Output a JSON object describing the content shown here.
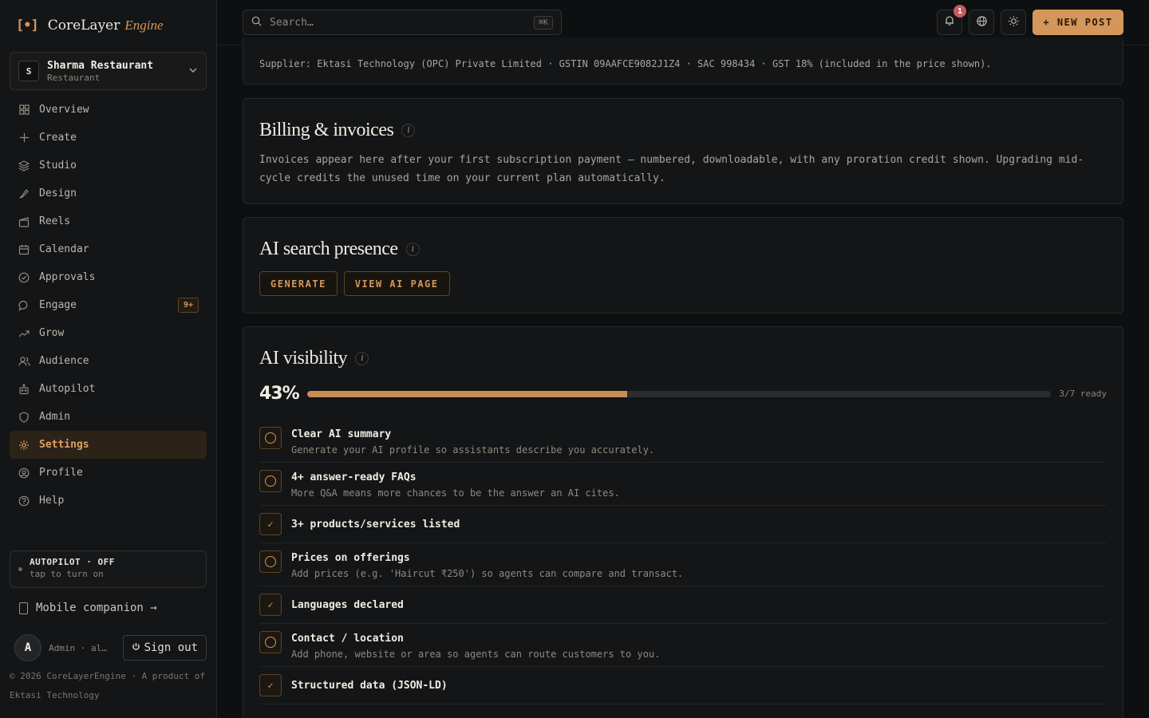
{
  "brand": {
    "logo": "[•]",
    "name": "CoreLayer",
    "suffix": "Engine"
  },
  "workspace": {
    "initial": "S",
    "name": "Sharma Restaurant",
    "type": "Restaurant"
  },
  "nav": [
    {
      "label": "Overview",
      "icon": "grid-icon"
    },
    {
      "label": "Create",
      "icon": "plus-icon"
    },
    {
      "label": "Studio",
      "icon": "layers-icon"
    },
    {
      "label": "Design",
      "icon": "palette-icon"
    },
    {
      "label": "Reels",
      "icon": "clapper-icon"
    },
    {
      "label": "Calendar",
      "icon": "calendar-icon"
    },
    {
      "label": "Approvals",
      "icon": "check-circle-icon"
    },
    {
      "label": "Engage",
      "icon": "chat-icon",
      "badge": "9+"
    },
    {
      "label": "Grow",
      "icon": "trend-icon"
    },
    {
      "label": "Audience",
      "icon": "users-icon"
    },
    {
      "label": "Autopilot",
      "icon": "robot-icon"
    },
    {
      "label": "Admin",
      "icon": "shield-icon"
    },
    {
      "label": "Settings",
      "icon": "gear-icon",
      "active": true
    },
    {
      "label": "Profile",
      "icon": "user-circle-icon"
    },
    {
      "label": "Help",
      "icon": "help-icon"
    }
  ],
  "autopilot": {
    "title": "AUTOPILOT · OFF",
    "sub": "tap to turn on"
  },
  "mobile": {
    "label": "Mobile companion →"
  },
  "user": {
    "initial": "A",
    "label": "Admin · al…",
    "signout": "Sign out"
  },
  "footer": {
    "text": "© 2026 CoreLayerEngine · A product of Ektasi Technology"
  },
  "topbar": {
    "search_placeholder": "Search…",
    "shortcut": "⌘K",
    "notif_count": "1",
    "new_post": "+ NEW POST"
  },
  "supplier": {
    "text": "Supplier: Ektasi Technology (OPC) Private Limited · GSTIN 09AAFCE9082J1Z4 · SAC 998434 · GST 18% (included in the price shown)."
  },
  "billing": {
    "title": "Billing & invoices",
    "body": "Invoices appear here after your first subscription payment — numbered, downloadable, with any proration credit shown. Upgrading mid-cycle credits the unused time on your current plan automatically."
  },
  "ai_search": {
    "title": "AI search presence",
    "generate": "GENERATE",
    "view": "VIEW AI PAGE"
  },
  "ai_visibility": {
    "title": "AI visibility",
    "percent_label": "43%",
    "progress": 0.43,
    "ready_label": "3/7 ready",
    "items": [
      {
        "title": "Clear AI summary",
        "desc": "Generate your AI profile so assistants describe you accurately.",
        "done": false
      },
      {
        "title": "4+ answer-ready FAQs",
        "desc": "More Q&A means more chances to be the answer an AI cites.",
        "done": false
      },
      {
        "title": "3+ products/services listed",
        "desc": "",
        "done": true
      },
      {
        "title": "Prices on offerings",
        "desc": "Add prices (e.g. 'Haircut ₹250') so agents can compare and transact.",
        "done": false
      },
      {
        "title": "Languages declared",
        "desc": "",
        "done": true
      },
      {
        "title": "Contact / location",
        "desc": "Add phone, website or area so agents can route customers to you.",
        "done": false
      },
      {
        "title": "Structured data (JSON-LD)",
        "desc": "",
        "done": true
      }
    ]
  },
  "colors": {
    "accent": "#d4965a",
    "background": "#0e0f10",
    "card": "#141516",
    "badge": "#c45c5c"
  }
}
